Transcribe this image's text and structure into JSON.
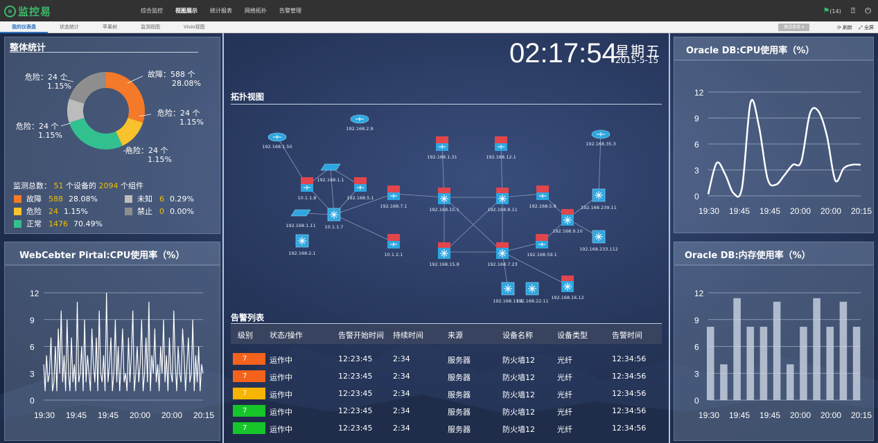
{
  "app": {
    "logo_text": "监控易",
    "logo_mark": "⊕"
  },
  "nav": [
    "综合监控",
    "视图展示",
    "统计报表",
    "网络拓扑",
    "告警管理"
  ],
  "nav_active": 1,
  "topright": {
    "alerts": "(14)",
    "help_icon": "help-icon",
    "power_icon": "power-icon"
  },
  "subtabs": [
    "我的仪表盘",
    "状态统计",
    "苹果树",
    "监测视图",
    "Visio视图"
  ],
  "sub_active": 0,
  "subright": {
    "dropdown": "激活菜单",
    "refresh": "刷新",
    "fullscreen": "全屏"
  },
  "clock": {
    "time": "02:17:54",
    "weekday": "星期五",
    "date": "2015-5-15"
  },
  "overview": {
    "title": "整体统计",
    "donut_labels": [
      {
        "text": "故障：588 个",
        "pct": "28.08%"
      },
      {
        "text": "危险：24 个",
        "pct": "1.15%"
      },
      {
        "text": "危险：24 个",
        "pct": "1.15%"
      },
      {
        "text": "危险：24 个",
        "pct": "1.15%"
      },
      {
        "text": "危险：24 个",
        "pct": "1.15%"
      }
    ],
    "summary": {
      "prefix": "监测总数：",
      "devices": "51",
      "mid": "个设备的",
      "components": "2094",
      "suffix": "个组件"
    },
    "legend": [
      {
        "name": "故障",
        "count": "588",
        "pct": "28.08%",
        "color": "#f47a2a"
      },
      {
        "name": "未知",
        "count": "6",
        "pct": "0.29%",
        "color": "#bcbcbc"
      },
      {
        "name": "危险",
        "count": "24",
        "pct": "1.15%",
        "color": "#f7c22b"
      },
      {
        "name": "禁止",
        "count": "0",
        "pct": "0.00%",
        "color": "#8e8e8e"
      },
      {
        "name": "正常",
        "count": "1476",
        "pct": "70.49%",
        "color": "#33c08f"
      }
    ]
  },
  "topology": {
    "title": "拓扑视图"
  },
  "alarms": {
    "title": "告警列表",
    "headers": [
      "级别",
      "状态/操作",
      "告警开始时间",
      "持续时间",
      "来源",
      "设备名称",
      "设备类型",
      "告警时间"
    ],
    "rows": [
      {
        "level": "7",
        "color": "#f4621c",
        "status": "运作中",
        "start": "12:23:45",
        "duration": "2:34",
        "source": "服务器",
        "device": "防火墙12",
        "type": "光纤",
        "time": "12:34:56"
      },
      {
        "level": "7",
        "color": "#f4621c",
        "status": "运作中",
        "start": "12:23:45",
        "duration": "2:34",
        "source": "服务器",
        "device": "防火墙12",
        "type": "光纤",
        "time": "12:34:56"
      },
      {
        "level": "7",
        "color": "#f7b400",
        "status": "运作中",
        "start": "12:23:45",
        "duration": "2:34",
        "source": "服务器",
        "device": "防火墙12",
        "type": "光纤",
        "time": "12:34:56"
      },
      {
        "level": "7",
        "color": "#16c52a",
        "status": "运作中",
        "start": "12:23:45",
        "duration": "2:34",
        "source": "服务器",
        "device": "防火墙12",
        "type": "光纤",
        "time": "12:34:56"
      },
      {
        "level": "7",
        "color": "#16c52a",
        "status": "运作中",
        "start": "12:23:45",
        "duration": "2:34",
        "source": "服务器",
        "device": "防火墙12",
        "type": "光纤",
        "time": "12:34:56"
      }
    ]
  },
  "web_cpu": {
    "title": "WebCebter Pirtal:CPU使用率（%）"
  },
  "oracle_cpu": {
    "title": "Oracle DB:CPU使用率（%）"
  },
  "oracle_mem": {
    "title": "Oracle DB:内存使用率（%）"
  },
  "chart_data": [
    {
      "type": "pie",
      "title": "整体统计",
      "categories": [
        "故障",
        "危险",
        "正常",
        "未知",
        "禁止"
      ],
      "values": [
        588,
        24,
        1476,
        6,
        0
      ],
      "colors": [
        "#f47a2a",
        "#f7c22b",
        "#33c08f",
        "#bcbcbc",
        "#8e8e8e"
      ]
    },
    {
      "type": "line",
      "title": "WebCebter Pirtal:CPU使用率（%）",
      "x_ticks": [
        "19:30",
        "19:45",
        "19:45",
        "20:00",
        "20:00",
        "20:15"
      ],
      "ylim": [
        0,
        12
      ],
      "y_ticks": [
        0,
        3,
        6,
        9,
        12
      ],
      "values": [
        4,
        1,
        5,
        2,
        3,
        7,
        1,
        2,
        6,
        1,
        8,
        3,
        10,
        2,
        5,
        1,
        9,
        3,
        1,
        7,
        2,
        4,
        1,
        11,
        2,
        3,
        6,
        1,
        9,
        2,
        5,
        3,
        1,
        8,
        4,
        2,
        7,
        1,
        10,
        3,
        2,
        5,
        1,
        12,
        2,
        4,
        7,
        1,
        3,
        9,
        2,
        6,
        1,
        4,
        8,
        2,
        3,
        1,
        7,
        2,
        5,
        10,
        1,
        3,
        6,
        2,
        4,
        9,
        1,
        3,
        7,
        2,
        11,
        1,
        5,
        3,
        8,
        2,
        4,
        1,
        6,
        3,
        9,
        2,
        5,
        1,
        7,
        3,
        2,
        10,
        4,
        1,
        6,
        3,
        2,
        8,
        5,
        1,
        4,
        7,
        2,
        3,
        9,
        1,
        5,
        2,
        6,
        1,
        4,
        3
      ]
    },
    {
      "type": "line",
      "title": "Oracle DB:CPU使用率（%）",
      "x_ticks": [
        "19:30",
        "19:45",
        "19:45",
        "20:00",
        "20:00",
        "20:15"
      ],
      "ylim": [
        0,
        12
      ],
      "y_ticks": [
        0,
        3,
        6,
        9,
        12
      ],
      "x": [
        0,
        1,
        2,
        3,
        4,
        5,
        6,
        7,
        8,
        9,
        10,
        11,
        12,
        13,
        14,
        15,
        16,
        17,
        18
      ],
      "values": [
        0.2,
        3.8,
        2.5,
        0.3,
        1.0,
        10.8,
        8.0,
        2.0,
        1.3,
        2.4,
        3.6,
        4.0,
        9.5,
        9.8,
        7.0,
        1.8,
        3.2,
        3.6,
        3.6
      ]
    },
    {
      "type": "bar",
      "title": "Oracle DB:内存使用率（%）",
      "x_ticks": [
        "19:30",
        "19:45",
        "19:45",
        "20:00",
        "20:00",
        "20:15"
      ],
      "ylim": [
        0,
        12
      ],
      "y_ticks": [
        0,
        3,
        6,
        9,
        12
      ],
      "values": [
        8.2,
        4.0,
        11.4,
        8.2,
        8.2,
        11.0,
        4.0,
        8.2,
        11.4,
        8.2,
        11.0,
        8.2
      ]
    }
  ]
}
